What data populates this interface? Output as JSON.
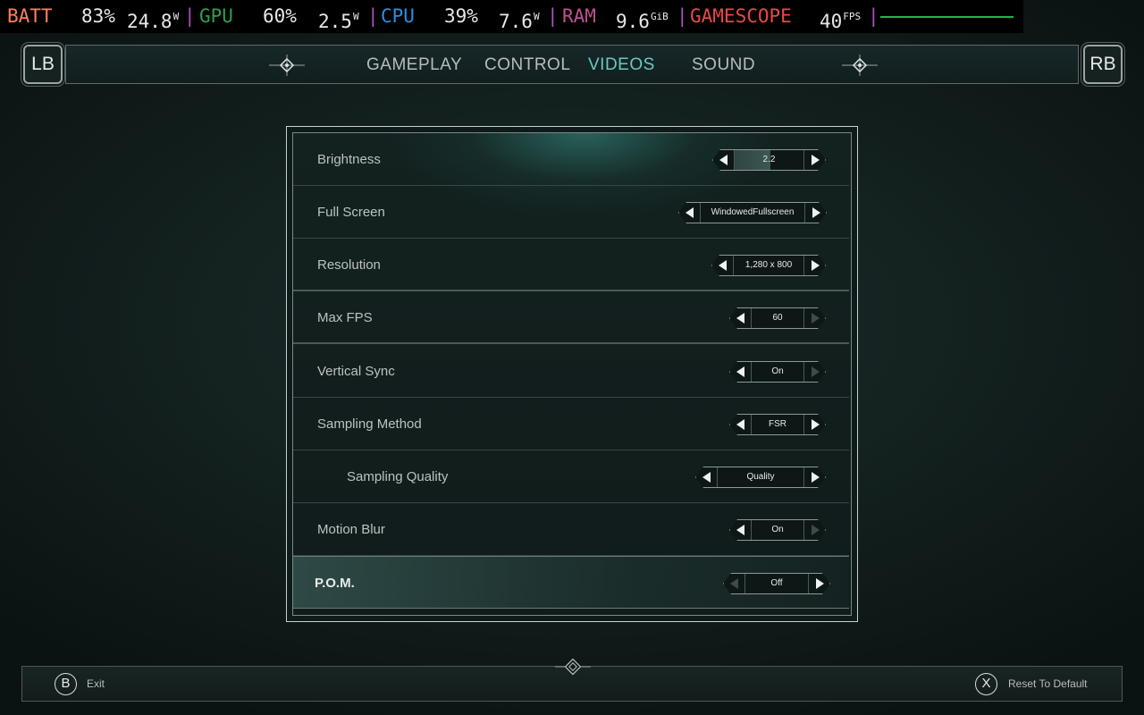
{
  "overlay": {
    "batt_label": "BATT",
    "batt_pct": "83%",
    "batt_w": "24.8",
    "batt_w_unit": "W",
    "gpu_label": "GPU",
    "gpu_pct": "60%",
    "gpu_w": "2.5",
    "gpu_w_unit": "W",
    "cpu_label": "CPU",
    "cpu_pct": "39%",
    "cpu_w": "7.6",
    "cpu_w_unit": "W",
    "ram_label": "RAM",
    "ram_val": "9.6",
    "ram_unit": "GiB",
    "gs_label": "GAMESCOPE",
    "fps_val": "40",
    "fps_unit": "FPS",
    "separator": "|",
    "colors": {
      "batt": "#ff7f5a",
      "gpu": "#2e9e4f",
      "cpu": "#2b8fe0",
      "ram": "#c0508e",
      "gamescope": "#e84848",
      "fps_line": "#1fb84a"
    }
  },
  "nav": {
    "lb": "LB",
    "rb": "RB",
    "tabs": [
      {
        "label": "GAMEPLAY",
        "active": false
      },
      {
        "label": "CONTROL",
        "active": false
      },
      {
        "label": "VIDEOS",
        "active": true
      },
      {
        "label": "SOUND",
        "active": false
      }
    ],
    "active_color": "#69c9c0"
  },
  "settings": [
    {
      "label": "Brightness",
      "value": "2.2",
      "slider_fill": 0.5
    },
    {
      "label": "Full Screen",
      "value": "WindowedFullscreen"
    },
    {
      "label": "Resolution",
      "value": "1,280 x 800"
    },
    {
      "label": "Max FPS",
      "value": "60",
      "right_disabled": true
    },
    {
      "label": "Vertical Sync",
      "value": "On",
      "right_disabled": true
    },
    {
      "label": "Sampling Method",
      "value": "FSR"
    },
    {
      "label": "Sampling Quality",
      "value": "Quality",
      "indented": true
    },
    {
      "label": "Motion Blur",
      "value": "On",
      "right_disabled": true
    },
    {
      "label": "P.O.M.",
      "value": "Off",
      "left_disabled": true,
      "selected": true
    }
  ],
  "footer": {
    "exit_button": "B",
    "exit_label": "Exit",
    "reset_button": "X",
    "reset_label": "Reset To Default"
  }
}
